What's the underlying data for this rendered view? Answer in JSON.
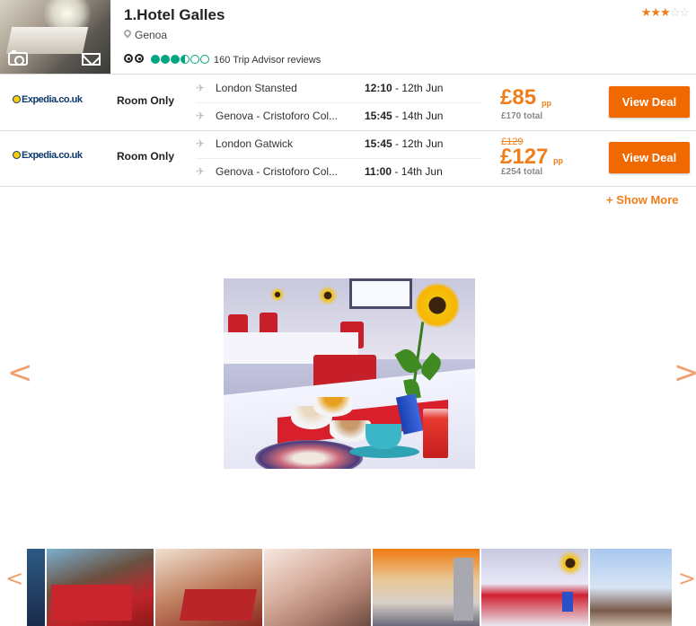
{
  "hotel": {
    "title": "1.Hotel Galles",
    "location": "Genoa",
    "stars": 3,
    "star_display": "★★★☆☆",
    "reviews": "160 Trip Advisor reviews",
    "rating_bubbles": 3.5,
    "icons": [
      "camera-icon",
      "mail-icon",
      "map-pin-icon",
      "tripadvisor-owl-icon"
    ]
  },
  "deals": [
    {
      "provider": "Expedia.co.uk",
      "room": "Room Only",
      "outbound": {
        "airport": "London Stansted",
        "time": "12:10",
        "date": "- 12th Jun"
      },
      "inbound": {
        "airport": "Genova - Cristoforo Col...",
        "time": "15:45",
        "date": "- 14th Jun"
      },
      "price": "£85",
      "per": "pp",
      "total": "£170 total",
      "old_price": "",
      "button": "View Deal"
    },
    {
      "provider": "Expedia.co.uk",
      "room": "Room Only",
      "outbound": {
        "airport": "London Gatwick",
        "time": "15:45",
        "date": "- 12th Jun"
      },
      "inbound": {
        "airport": "Genova - Cristoforo Col...",
        "time": "11:00",
        "date": "- 14th Jun"
      },
      "price": "£127",
      "per": "pp",
      "total": "£254 total",
      "old_price": "£129",
      "button": "View Deal"
    }
  ],
  "show_more": "+ Show More",
  "gallery": {
    "prev": "<",
    "next": ">",
    "strip_prev": "<",
    "strip_next": ">"
  },
  "colors": {
    "accent": "#f07e1b",
    "button": "#f06800",
    "tripadvisor": "#00a680",
    "expedia": "#0c3a6b"
  }
}
